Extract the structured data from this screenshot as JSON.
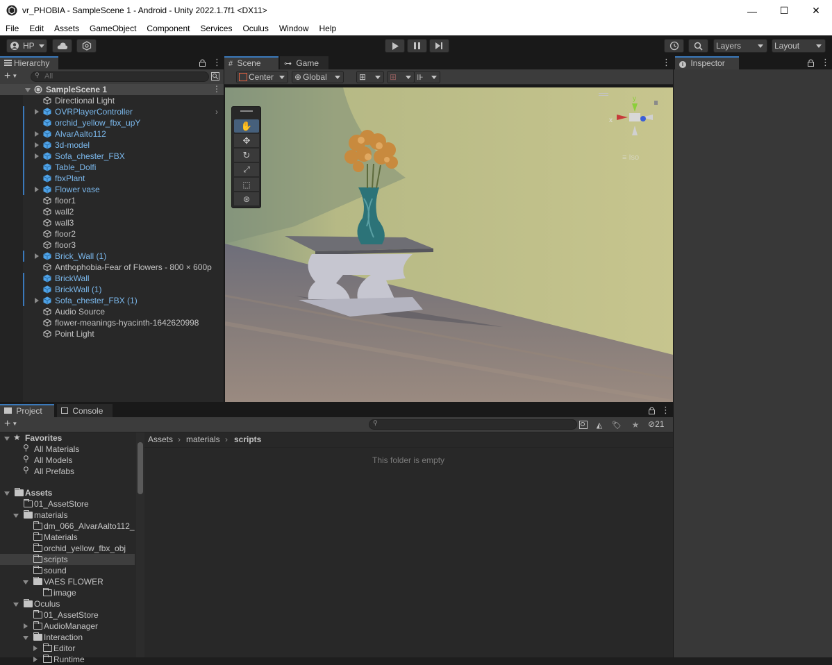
{
  "window": {
    "title": "vr_PHOBIA - SampleScene 1 - Android - Unity 2022.1.7f1 <DX11>",
    "minimize": "—",
    "maximize": "☐",
    "close": "✕"
  },
  "menu": [
    "File",
    "Edit",
    "Assets",
    "GameObject",
    "Component",
    "Services",
    "Oculus",
    "Window",
    "Help"
  ],
  "toolbar": {
    "account": "HP",
    "layers": "Layers",
    "layout": "Layout"
  },
  "hierarchy": {
    "tab": "Hierarchy",
    "search_placeholder": "All",
    "scene": "SampleScene 1",
    "items": [
      {
        "label": "Directional Light",
        "prefab": false,
        "expand": false
      },
      {
        "label": "OVRPlayerController",
        "prefab": true,
        "expand": true
      },
      {
        "label": "orchid_yellow_fbx_upY",
        "prefab": true,
        "expand": false
      },
      {
        "label": "AlvarAalto112",
        "prefab": true,
        "expand": true
      },
      {
        "label": "3d-model",
        "prefab": true,
        "expand": true
      },
      {
        "label": "Sofa_chester_FBX",
        "prefab": true,
        "expand": true
      },
      {
        "label": "Table_Dolfi",
        "prefab": true,
        "expand": false
      },
      {
        "label": "fbxPlant",
        "prefab": true,
        "expand": false
      },
      {
        "label": "Flower vase",
        "prefab": true,
        "expand": true
      },
      {
        "label": "floor1",
        "prefab": false,
        "expand": false
      },
      {
        "label": "wall2",
        "prefab": false,
        "expand": false
      },
      {
        "label": "wall3",
        "prefab": false,
        "expand": false
      },
      {
        "label": "floor2",
        "prefab": false,
        "expand": false
      },
      {
        "label": "floor3",
        "prefab": false,
        "expand": false
      },
      {
        "label": "Brick_Wall (1)",
        "prefab": true,
        "expand": true
      },
      {
        "label": "Anthophobia-Fear of Flowers - 800 × 600p",
        "prefab": false,
        "expand": false
      },
      {
        "label": "BrickWall",
        "prefab": true,
        "expand": false
      },
      {
        "label": "BrickWall (1)",
        "prefab": true,
        "expand": false
      },
      {
        "label": "Sofa_chester_FBX (1)",
        "prefab": true,
        "expand": true
      },
      {
        "label": "Audio Source",
        "prefab": false,
        "expand": false
      },
      {
        "label": "flower-meanings-hyacinth-1642620998",
        "prefab": false,
        "expand": false
      },
      {
        "label": "Point Light",
        "prefab": false,
        "expand": false
      }
    ]
  },
  "scene": {
    "tab_scene": "Scene",
    "tab_game": "Game",
    "pivot": "Center",
    "space": "Global",
    "gizmo_y": "y",
    "gizmo_x": "x",
    "gizmo_persp": "Iso"
  },
  "inspector": {
    "tab": "Inspector"
  },
  "project": {
    "tab_project": "Project",
    "tab_console": "Console",
    "hidden_count": "21",
    "favorites": "Favorites",
    "favorite_items": [
      "All Materials",
      "All Models",
      "All Prefabs"
    ],
    "assets": "Assets",
    "tree": [
      {
        "label": "01_AssetStore",
        "level": 1,
        "open": false,
        "expand": "none"
      },
      {
        "label": "materials",
        "level": 1,
        "open": true,
        "expand": "down"
      },
      {
        "label": "dm_066_AlvarAalto112_",
        "level": 2,
        "open": false,
        "expand": "none"
      },
      {
        "label": "Materials",
        "level": 2,
        "open": false,
        "expand": "none"
      },
      {
        "label": "orchid_yellow_fbx_obj",
        "level": 2,
        "open": false,
        "expand": "none"
      },
      {
        "label": "scripts",
        "level": 2,
        "open": false,
        "expand": "none",
        "selected": true
      },
      {
        "label": "sound",
        "level": 2,
        "open": false,
        "expand": "none"
      },
      {
        "label": "VAES FLOWER",
        "level": 2,
        "open": true,
        "expand": "down"
      },
      {
        "label": "image",
        "level": 3,
        "open": false,
        "expand": "none"
      },
      {
        "label": "Oculus",
        "level": 1,
        "open": true,
        "expand": "down"
      },
      {
        "label": "01_AssetStore",
        "level": 2,
        "open": false,
        "expand": "none"
      },
      {
        "label": "AudioManager",
        "level": 2,
        "open": false,
        "expand": "right"
      },
      {
        "label": "Interaction",
        "level": 2,
        "open": true,
        "expand": "down"
      },
      {
        "label": "Editor",
        "level": 3,
        "open": false,
        "expand": "right"
      },
      {
        "label": "Runtime",
        "level": 3,
        "open": false,
        "expand": "right"
      }
    ],
    "breadcrumb": [
      "Assets",
      "materials",
      "scripts"
    ],
    "empty_message": "This folder is empty"
  }
}
